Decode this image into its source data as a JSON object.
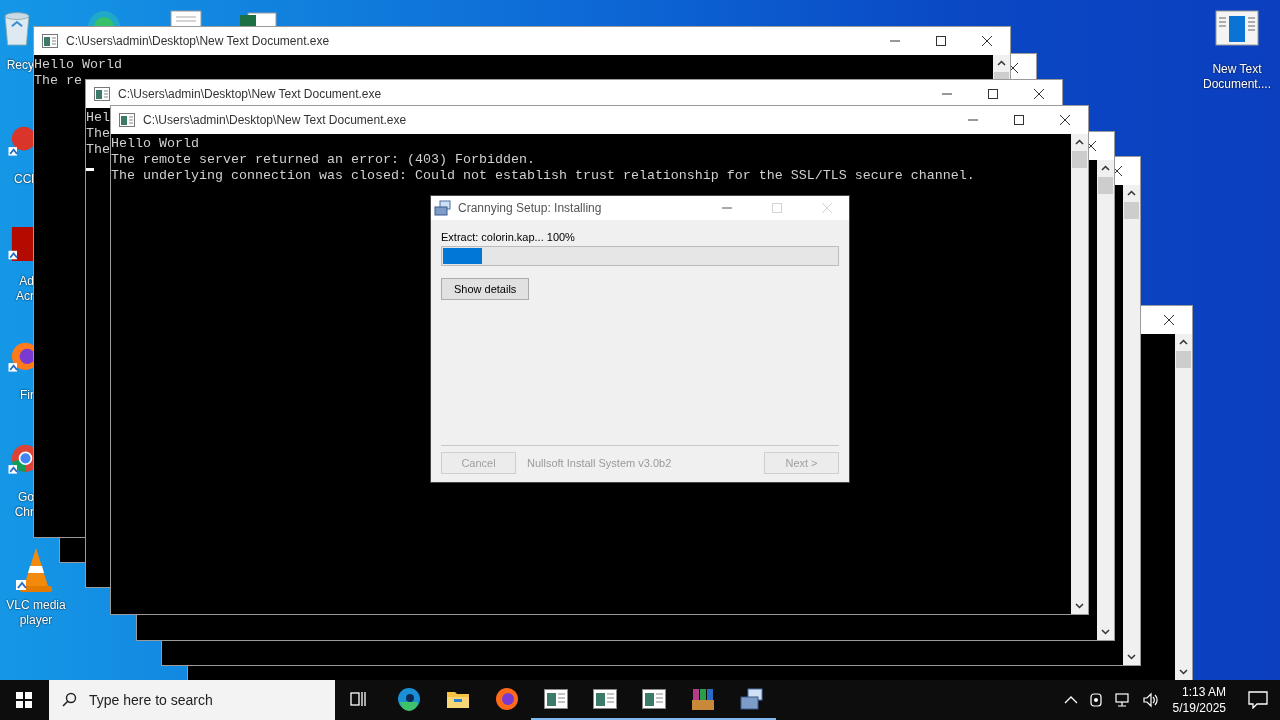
{
  "desktop_icons": [
    {
      "kind": "recycle",
      "lines": [
        "Recy"
      ]
    },
    {
      "kind": "ccleaner",
      "lines": [
        "CCl"
      ]
    },
    {
      "kind": "acrobat",
      "lines": [
        "Ad",
        "Acr"
      ]
    },
    {
      "kind": "firefox",
      "lines": [
        "Fir"
      ]
    },
    {
      "kind": "chrome",
      "lines": [
        "Go",
        "Chr"
      ]
    },
    {
      "kind": "vlc",
      "lines": [
        "VLC media",
        "player"
      ]
    },
    {
      "kind": "console",
      "lines": [
        "New Text",
        "Document...."
      ]
    }
  ],
  "peek_icons": [
    {
      "kind": "edge"
    },
    {
      "kind": "document"
    },
    {
      "kind": "excel"
    }
  ],
  "console_windows": [
    {
      "title": "C:\\Users\\admin\\Desktop\\New Text Document.exe",
      "lines": [
        "Hello World",
        "The re"
      ],
      "cursor": false
    },
    {
      "title": "C:\\Users\\admin\\Desktop\\New Text Document.exe",
      "lines": [
        "Hel",
        "The",
        "The"
      ],
      "cursor": true
    },
    {
      "title": "C:\\Users\\admin\\Desktop\\New Text Document.exe",
      "lines": [
        "Hello World",
        "The remote server returned an error: (403) Forbidden.",
        "The underlying connection was closed: Could not establish trust relationship for the SSL/TLS secure channel."
      ],
      "cursor": false
    }
  ],
  "installer": {
    "title": "Crannying Setup: Installing",
    "maximize_disabled": true,
    "close_disabled": true,
    "status": "Extract: colorin.kap... 100%",
    "progress": {
      "level": 0.1
    },
    "details_button": "Show details",
    "branding": "Nullsoft Install System v3.0b2",
    "buttons": [
      {
        "label": "Cancel",
        "disabled": true
      },
      {
        "label": "Next >",
        "disabled": true
      }
    ]
  },
  "taskbar": {
    "search": {
      "placeholder": "Type here to search"
    },
    "apps": [
      {
        "kind": "taskview",
        "running": false
      },
      {
        "kind": "edge",
        "running": false
      },
      {
        "kind": "folder",
        "running": false
      },
      {
        "kind": "firefox",
        "running": false
      },
      {
        "kind": "console",
        "running": true
      },
      {
        "kind": "console",
        "running": true
      },
      {
        "kind": "console",
        "running": true
      },
      {
        "kind": "archive",
        "running": true
      },
      {
        "kind": "installer",
        "running": true
      }
    ],
    "time": "1:13 AM",
    "date": "5/19/2025"
  }
}
